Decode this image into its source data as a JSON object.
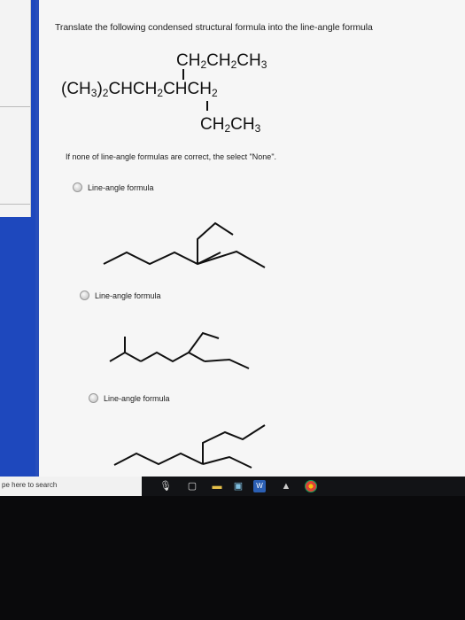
{
  "question": {
    "prompt": "Translate the following condensed structural formula into the line-angle formula",
    "formula_top": "CH2CH2CH3",
    "formula_main_left": "(CH3)2CHCH2",
    "formula_main_right": "CHCH2",
    "formula_bottom": "CH2CH3",
    "note": "If none of line-angle formulas are correct, the select \"None\"."
  },
  "options": [
    {
      "label": "Line-angle formula"
    },
    {
      "label": "Line-angle formula"
    },
    {
      "label": "Line-angle formula"
    }
  ],
  "taskbar": {
    "search_placeholder": "pe here to search"
  },
  "colors": {
    "desktop_blue": "#2547b0",
    "page_bg": "#f6f6f6",
    "taskbar": "#121316"
  }
}
